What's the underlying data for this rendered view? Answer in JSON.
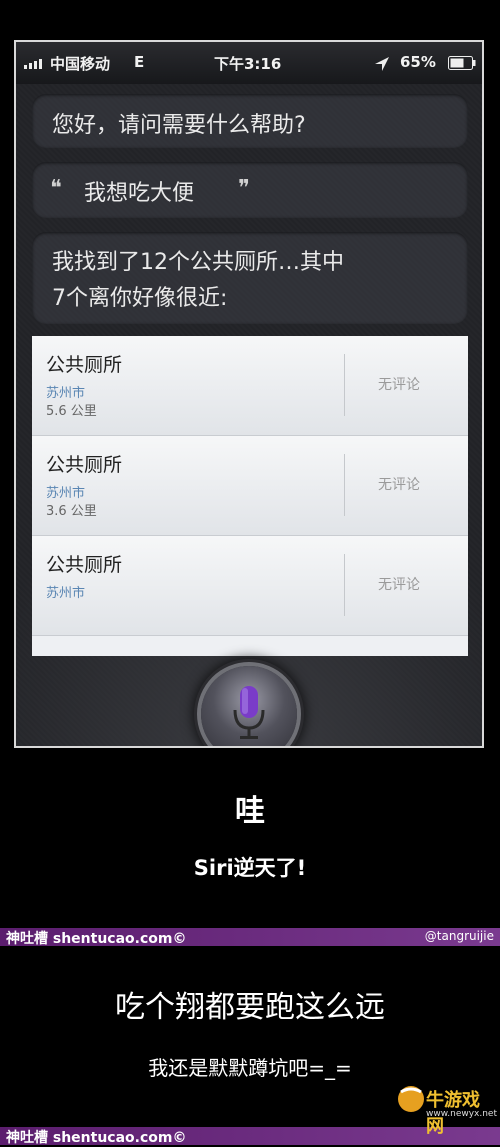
{
  "status_bar": {
    "carrier": "中国移动",
    "network": "E",
    "time": "下午3:16",
    "battery": "65%",
    "icons": [
      "signal-bars-icon",
      "location-arrow-icon",
      "battery-icon"
    ]
  },
  "siri": {
    "greeting": "您好，请问需要什么帮助?",
    "user_query": "我想吃大便",
    "quote_open": "❝",
    "quote_close": "❞",
    "response_line1": "我找到了12个公共厕所…其中",
    "response_line2": "7个离你好像很近:",
    "results": [
      {
        "name": "公共厕所",
        "city": "苏州市",
        "distance": "5.6 公里",
        "rating": "无评论"
      },
      {
        "name": "公共厕所",
        "city": "苏州市",
        "distance": "3.6 公里",
        "rating": "无评论"
      },
      {
        "name": "公共厕所",
        "city": "苏州市",
        "distance": "",
        "rating": "无评论"
      }
    ],
    "mic_icon": "microphone-icon"
  },
  "meme": {
    "caption_title": "哇",
    "caption_subtitle": "Siri逆天了!",
    "watermark_site": "神吐槽 shentucao.com©",
    "watermark_author": "@tangruijie",
    "punchline": "吃个翔都要跑这么远",
    "sub_punchline": "我还是默默蹲坑吧=_=",
    "bottom_site": "神吐槽 shentucao.com©",
    "corner_logo": "牛游戏网",
    "corner_url": "www.newyx.net"
  },
  "colors": {
    "band": "#6a2a80",
    "city_text": "#5a86b3",
    "mic": "#7a3cc8"
  }
}
